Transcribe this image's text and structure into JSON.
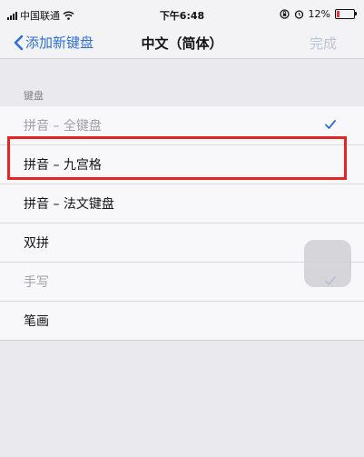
{
  "status_bar": {
    "carrier": "中国联通",
    "time": "下午6:48",
    "battery_percent": "12%",
    "battery_level": 0.12
  },
  "nav": {
    "back_label": "添加新键盘",
    "title": "中文（简体）",
    "done_label": "完成"
  },
  "section": {
    "header": "键盘"
  },
  "keyboards": [
    {
      "label": "拼音 – 全键盘",
      "checked": true,
      "dimmed": true
    },
    {
      "label": "拼音 – 九宫格",
      "checked": false,
      "dimmed": false
    },
    {
      "label": "拼音 – 法文键盘",
      "checked": false,
      "dimmed": false
    },
    {
      "label": "双拼",
      "checked": false,
      "dimmed": false
    },
    {
      "label": "手写",
      "checked": true,
      "dimmed": true
    },
    {
      "label": "笔画",
      "checked": false,
      "dimmed": false
    }
  ],
  "colors": {
    "accent": "#2d6fd6",
    "highlight_border": "#e52424",
    "background": "#e9e9ee"
  }
}
